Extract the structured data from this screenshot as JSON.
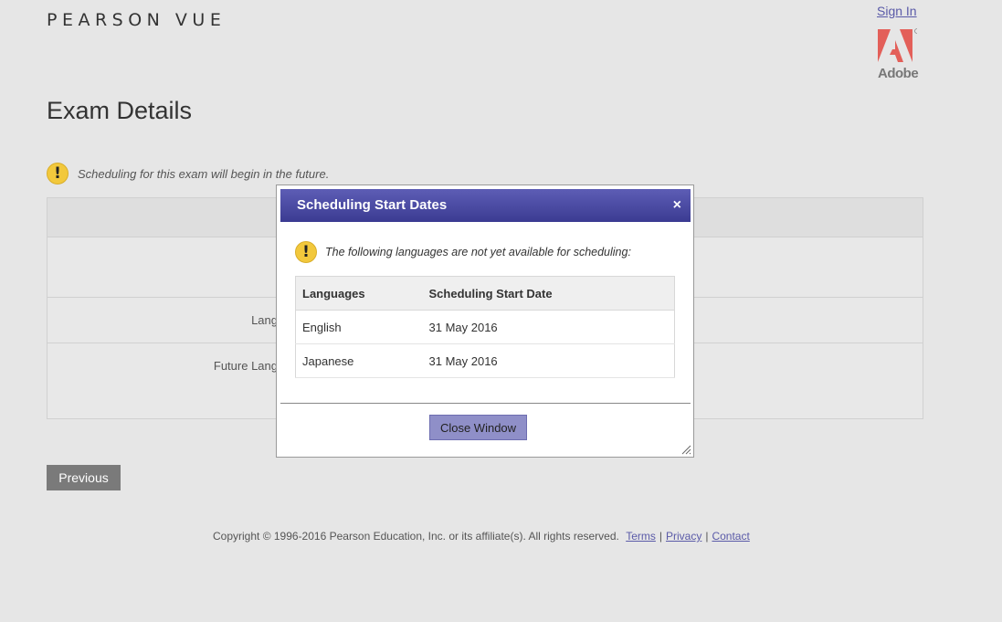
{
  "header": {
    "logo": "PEARSON VUE",
    "sign_in": "Sign In",
    "adobe_label": "Adobe"
  },
  "page": {
    "title": "Exam Details",
    "notice": "Scheduling for this exam will begin in the future."
  },
  "background_table": {
    "row2_label": "Lang",
    "row3_label": "Future Lang"
  },
  "buttons": {
    "previous": "Previous"
  },
  "footer": {
    "copyright": "Copyright © 1996-2016 Pearson Education, Inc. or its affiliate(s). All rights reserved.",
    "terms": "Terms",
    "privacy": "Privacy",
    "contact": "Contact",
    "separator": "|"
  },
  "modal": {
    "title": "Scheduling Start Dates",
    "close_symbol": "×",
    "notice": "The following languages are not yet available for scheduling:",
    "columns": [
      "Languages",
      "Scheduling Start Date"
    ],
    "rows": [
      {
        "language": "English",
        "date": "31 May 2016"
      },
      {
        "language": "Japanese",
        "date": "31 May 2016"
      }
    ],
    "close_button": "Close Window"
  },
  "colors": {
    "modal_title_bg": "#4a4aa3",
    "warning_icon": "#f2c83c",
    "link": "#5a5aa8",
    "adobe_red": "#e2322a"
  },
  "icons": {
    "warning": "exclamation-icon",
    "adobe": "adobe-logo-icon",
    "close": "close-icon"
  }
}
